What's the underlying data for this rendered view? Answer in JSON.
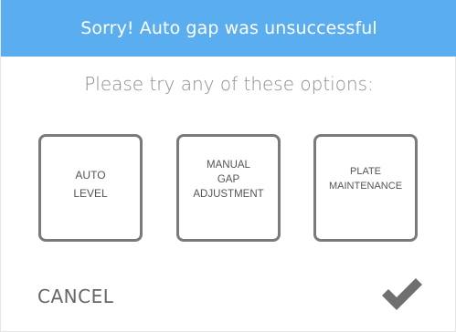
{
  "dialog": {
    "title": "Sorry! Auto gap was unsuccessful",
    "prompt": "Please try any of these options:",
    "options": [
      {
        "label": "AUTO\nLEVEL"
      },
      {
        "label": "MANUAL\nGAP\nADJUSTMENT"
      },
      {
        "label": "PLATE\nMAINTENANCE"
      }
    ],
    "cancel_label": "CANCEL",
    "confirm_icon": "checkmark-icon"
  },
  "colors": {
    "header_bg": "#5aaef0",
    "header_text": "#ffffff",
    "prompt_text": "#8c8c8c",
    "option_border": "#7a7a7a",
    "option_text": "#555555",
    "cancel_text": "#666666",
    "check": "#6f6f6f"
  }
}
